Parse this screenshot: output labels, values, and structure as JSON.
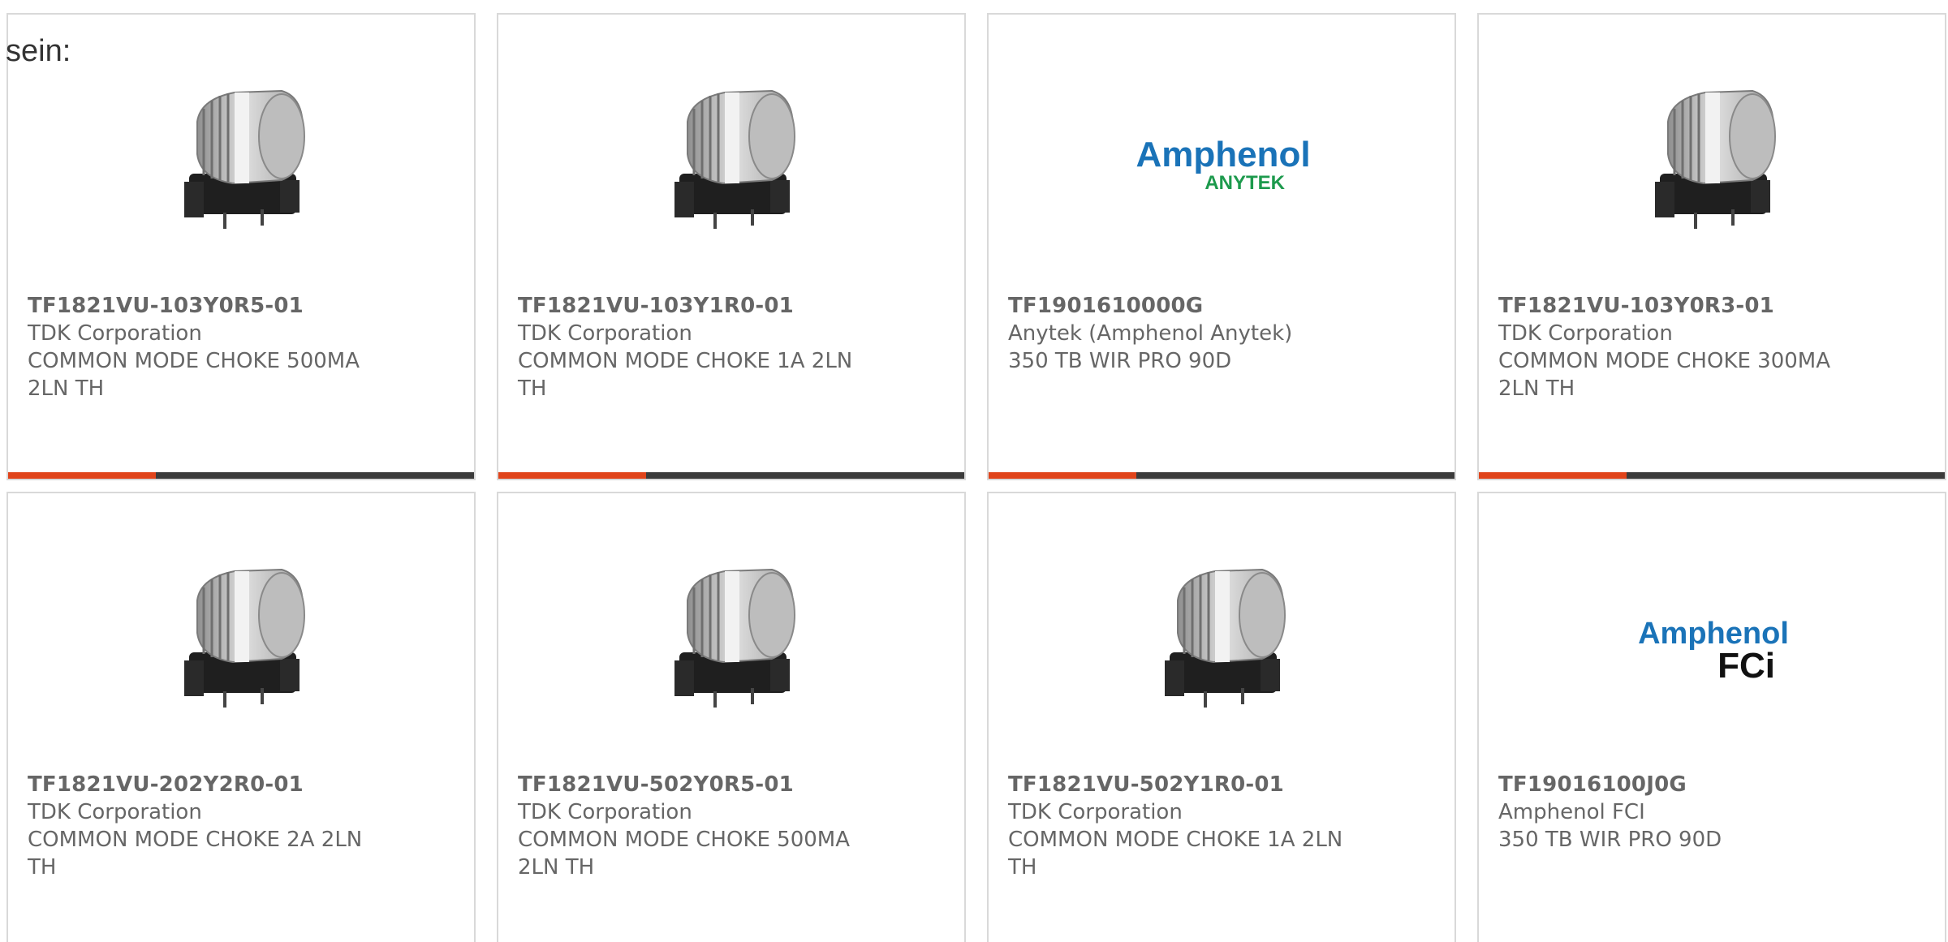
{
  "intro_text": "sein:",
  "colors": {
    "accent": "#e0441b",
    "bar": "#3b3b3b",
    "border": "#d9d9d9",
    "text": "#666666",
    "amphenol_blue": "#1a73b8",
    "anytek_green": "#1d9a4d"
  },
  "cards": [
    {
      "part_number": "TF1821VU-103Y0R5-01",
      "manufacturer": "TDK Corporation",
      "description": "COMMON MODE CHOKE 500MA 2LN TH",
      "image": "toroidal-choke-icon"
    },
    {
      "part_number": "TF1821VU-103Y1R0-01",
      "manufacturer": "TDK Corporation",
      "description": "COMMON MODE CHOKE 1A 2LN TH",
      "image": "toroidal-choke-icon"
    },
    {
      "part_number": "TF1901610000G",
      "manufacturer": "Anytek (Amphenol Anytek)",
      "description": "350 TB WIR PRO 90D",
      "image": "amphenol-anytek-logo",
      "logo_text": {
        "brand": "Amphenol",
        "sub": "ANYTEK"
      }
    },
    {
      "part_number": "TF1821VU-103Y0R3-01",
      "manufacturer": "TDK Corporation",
      "description": "COMMON MODE CHOKE 300MA 2LN TH",
      "image": "toroidal-choke-icon"
    },
    {
      "part_number": "TF1821VU-202Y2R0-01",
      "manufacturer": "TDK Corporation",
      "description": "COMMON MODE CHOKE 2A 2LN TH",
      "image": "toroidal-choke-icon"
    },
    {
      "part_number": "TF1821VU-502Y0R5-01",
      "manufacturer": "TDK Corporation",
      "description": "COMMON MODE CHOKE 500MA 2LN TH",
      "image": "toroidal-choke-icon"
    },
    {
      "part_number": "TF1821VU-502Y1R0-01",
      "manufacturer": "TDK Corporation",
      "description": "COMMON MODE CHOKE 1A 2LN TH",
      "image": "toroidal-choke-icon"
    },
    {
      "part_number": "TF19016100J0G",
      "manufacturer": "Amphenol FCI",
      "description": "350 TB WIR PRO 90D",
      "image": "amphenol-fci-logo",
      "logo_text": {
        "brand": "Amphenol",
        "sub": "FCi"
      }
    }
  ]
}
